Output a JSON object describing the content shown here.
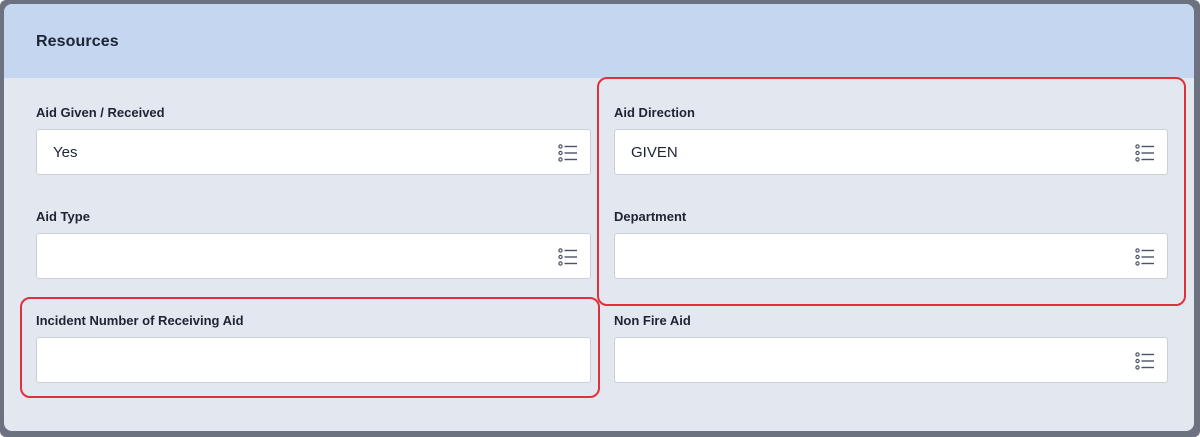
{
  "section": {
    "title": "Resources"
  },
  "fields": {
    "aid_given_received": {
      "label": "Aid Given / Received",
      "value": "Yes",
      "icon": "list-icon"
    },
    "aid_direction": {
      "label": "Aid Direction",
      "value": "GIVEN",
      "icon": "list-icon"
    },
    "aid_type": {
      "label": "Aid Type",
      "value": "",
      "icon": "list-icon"
    },
    "department": {
      "label": "Department",
      "value": "",
      "icon": "list-icon"
    },
    "incident_number_receiving_aid": {
      "label": "Incident Number of Receiving Aid",
      "value": ""
    },
    "non_fire_aid": {
      "label": "Non Fire Aid",
      "value": "",
      "icon": "list-icon"
    }
  },
  "colors": {
    "header_bg": "#c5d6f0",
    "card_bg": "#e3e8f0",
    "highlight": "#e0303c"
  }
}
